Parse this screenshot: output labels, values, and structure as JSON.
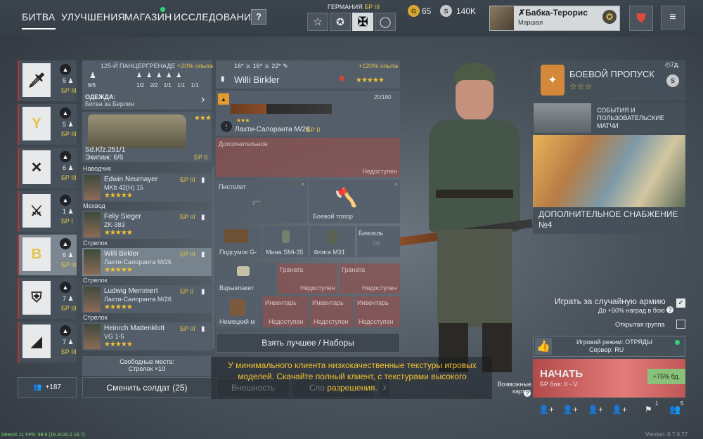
{
  "nav": {
    "battle": "БИТВА",
    "upgrades": "УЛУЧШЕНИЯ",
    "shop": "МАГАЗИН",
    "research": "ИССЛЕДОВАНИЯ",
    "help": "?"
  },
  "nation": {
    "label": "ГЕРМАНИЯ",
    "br": "БР III"
  },
  "currency": {
    "gold": "65",
    "silver": "140K"
  },
  "player": {
    "name": "Бабка-Терорис",
    "rank": "Маршал"
  },
  "squads": [
    {
      "count": "5",
      "br": "БР III"
    },
    {
      "count": "5",
      "br": "БР III"
    },
    {
      "count": "6",
      "br": "БР III"
    },
    {
      "count": "1",
      "br": "БР I"
    },
    {
      "count": "6",
      "br": "БР III"
    },
    {
      "count": "7",
      "br": "БР III"
    },
    {
      "count": "7",
      "br": "БР III"
    }
  ],
  "squad_add": "+187",
  "squad_info": {
    "title": "125-Й ПАНЦЕРГРЕНАДЕ",
    "bonus": "+20% опыта",
    "count": "6/6",
    "slots": [
      "1/2",
      "2/2",
      "1/1",
      "1/1",
      "1/1"
    ],
    "outfit_label": "ОДЕЖДА:",
    "outfit_value": "Битва за Берлин"
  },
  "vehicle": {
    "name": "Sd.Kfz.251/1",
    "crew": "Экипаж: 6/6",
    "br": "БР II",
    "stars": "★★★"
  },
  "soldiers": [
    {
      "role": "Наводчик",
      "name": "Edwin Neumayer",
      "weapon": "MKb 42(H) 15",
      "br": "БР III",
      "stars": "★★★★★"
    },
    {
      "role": "Мехвод",
      "name": "Feliy Sieger",
      "weapon": "ZK-383",
      "br": "БР III",
      "stars": "★★★★★"
    },
    {
      "role": "Стрелок",
      "name": "Willi Birkler",
      "weapon": "Лахти-Салоранта М/26",
      "br": "БР III",
      "stars": "★★★★★"
    },
    {
      "role": "Стрелок",
      "name": "Ludwig Memmert",
      "weapon": "Лахти-Салоранта М/26",
      "br": "БР II",
      "stars": "★★★★★"
    },
    {
      "role": "Стрелок",
      "name": "Heinrch Mattenklott",
      "weapon": "VG 1-5",
      "br": "БР III",
      "stars": "★★★★★"
    }
  ],
  "free_slots": {
    "label": "Свободные места:",
    "value": "Стрелок ×10"
  },
  "change_soldier": "Сменить солдат (25)",
  "soldier": {
    "stat1": "16*",
    "stat2": "16*",
    "stat3": "22*",
    "bonus": "+120% опыта",
    "name": "Willi Birkler",
    "stars": "★★★★★"
  },
  "weapon": {
    "name": "Лахти-Салоранта М/26",
    "br": "БР II",
    "ammo": "20/180",
    "stars": "★★★"
  },
  "slots": {
    "extra": "Дополнительное",
    "unavailable": "Недоступен",
    "pistol": "Пистолет",
    "axe": "Боевой топор",
    "pouch": "Подсумок G-",
    "mine": "Мина SMi-35",
    "flask": "Фляга M31",
    "binocular": "Бинокль",
    "detonator": "Взрывпакет",
    "grenade": "Граната",
    "backpack": "Немецкий м",
    "inventory": "Инвентарь"
  },
  "take_best": "Взять лучшее / Наборы",
  "perks_button": "Внешность",
  "sp_button": "Спо",
  "warning": "У минимального клиента низкокачественные текстуры игровых моделей. Скачайте полный клиент, с текстурами высокого разрешения.",
  "battle_pass": {
    "title": "БОЕВОЙ ПРОПУСК",
    "days": "7д.",
    "stars": "☆☆☆"
  },
  "events": {
    "title": "СОБЫТИЯ И ПОЛЬЗОВАТЕЛЬСКИЕ МАТЧИ"
  },
  "supply": {
    "title": "ДОПОЛНИТЕЛЬНОЕ СНАБЖЕНИЕ №4"
  },
  "random_army": {
    "label": "Играть за случайную армию",
    "sub": "До +50% наград в бою"
  },
  "open_group": "Открытая группа",
  "mode": {
    "label": "Игровой режим: ОТРЯДЫ",
    "server": "Сервер: RU"
  },
  "start": {
    "label": "НАЧАТЬ",
    "sub": "БР боя: II - V",
    "xp": "+75% бд."
  },
  "maps": {
    "label": "Возможные карты:"
  },
  "footer": {
    "fps": "DirectX 11 FPS: 59.8 (16.3<20.2 16.7)",
    "version": "Version: 0.7.0.77",
    "friends_count": "1",
    "group_count": "5"
  },
  "colors": {
    "accent": "#e3c24a",
    "start": "#d96060",
    "online": "#33d27a"
  }
}
